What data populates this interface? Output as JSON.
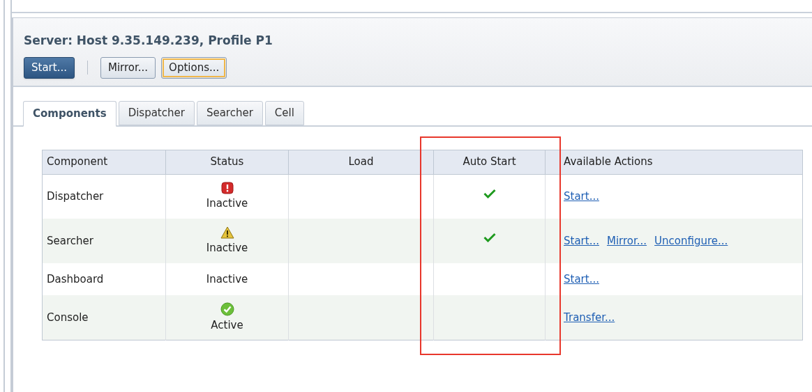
{
  "panel": {
    "title": "Server: Host 9.35.149.239, Profile P1"
  },
  "toolbar": [
    {
      "label": "Start...",
      "kind": "primary"
    },
    {
      "label": "Mirror...",
      "kind": "normal"
    },
    {
      "label": "Options...",
      "kind": "focused"
    }
  ],
  "tabs": [
    {
      "label": "Components",
      "selected": true
    },
    {
      "label": "Dispatcher",
      "selected": false
    },
    {
      "label": "Searcher",
      "selected": false
    },
    {
      "label": "Cell",
      "selected": false
    }
  ],
  "table": {
    "columns": [
      "Component",
      "Status",
      "Load",
      "Auto Start",
      "Available Actions"
    ],
    "rows": [
      {
        "component": "Dispatcher",
        "status": "Inactive",
        "kind": "error",
        "auto_start": true,
        "actions": [
          "Start..."
        ]
      },
      {
        "component": "Searcher",
        "status": "Inactive",
        "kind": "warning",
        "auto_start": true,
        "actions": [
          "Start...",
          "Mirror...",
          "Unconfigure..."
        ]
      },
      {
        "component": "Dashboard",
        "status": "Inactive",
        "kind": "none",
        "auto_start": false,
        "actions": [
          "Start..."
        ]
      },
      {
        "component": "Console",
        "status": "Active",
        "kind": "ok",
        "auto_start": false,
        "actions": [
          "Transfer..."
        ]
      }
    ]
  },
  "highlight": {
    "on": true
  }
}
